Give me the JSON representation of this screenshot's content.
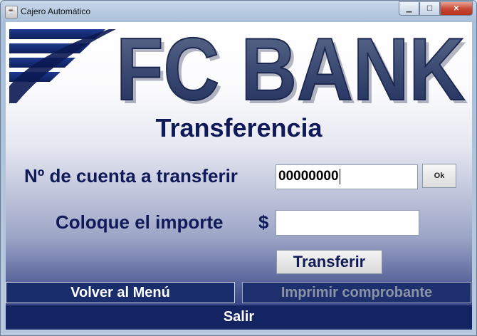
{
  "window": {
    "title": "Cajero Automático",
    "app_icon": "java-cup-icon",
    "buttons": {
      "minimize": "minimize-icon",
      "maximize": "maximize-icon",
      "close": "close-icon"
    }
  },
  "brand": {
    "logo_text": "FC BANK"
  },
  "screen": {
    "title": "Transferencia"
  },
  "form": {
    "account_label": "Nº de cuenta a transferir",
    "account_value": "00000000",
    "ok_label": "Ok",
    "amount_label": "Coloque el importe",
    "currency_symbol": "$",
    "amount_value": "",
    "transfer_label": "Transferir"
  },
  "footer": {
    "back_label": "Volver al Menú",
    "print_label": "Imprimir comprobante",
    "exit_label": "Salir"
  },
  "colors": {
    "brand_navy": "#101a58",
    "button_navy": "#192c6c",
    "disabled_text": "#8c93a6"
  }
}
